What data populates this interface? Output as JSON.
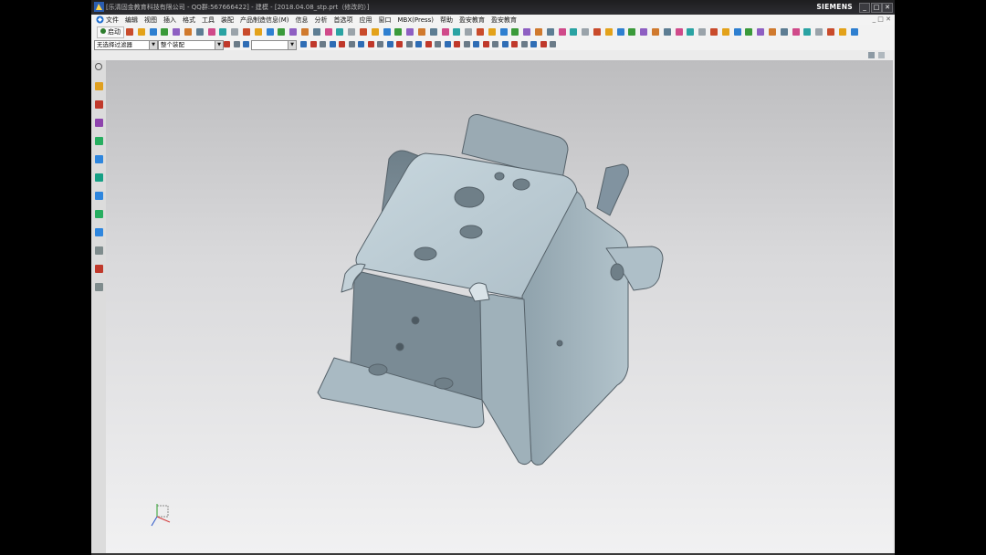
{
  "window": {
    "title": "[乐清固金教育科技有限公司 - QQ群:567666422] - 建模 - [2018.04.08_stp.prt（修改的）]",
    "brand": "SIEMENS",
    "controls": {
      "minimize": "_",
      "restore": "□",
      "close": "✕"
    }
  },
  "menubar": {
    "items": [
      "文件",
      "编辑",
      "视图",
      "插入",
      "格式",
      "工具",
      "装配",
      "产品制造信息(M)",
      "信息",
      "分析",
      "首选项",
      "应用",
      "窗口",
      "MBX(Press)",
      "帮助",
      "盈安教育",
      "盈安教育"
    ],
    "right_controls": "_ □ ✕"
  },
  "toolbar": {
    "start_label": "启动"
  },
  "selection_bar": {
    "filter_value": "无选择过滤器",
    "scope_value": "整个装配",
    "third_value": ""
  },
  "colors": {
    "titlebar": "#1d1d1f",
    "part_face_light": "#b9cad3",
    "part_face_dark": "#7e8f99",
    "part_edge": "#556068"
  },
  "icons": {
    "resource_bar": [
      "assembly-navigator-icon",
      "constraint-navigator-icon",
      "part-navigator-icon",
      "reuse-library-icon",
      "hd3d-tools-icon",
      "web-browser-icon",
      "history-icon",
      "system-materials-icon",
      "process-studio-icon",
      "manufacturing-wizards-icon",
      "roles-icon",
      "system-scenes-icon"
    ]
  }
}
